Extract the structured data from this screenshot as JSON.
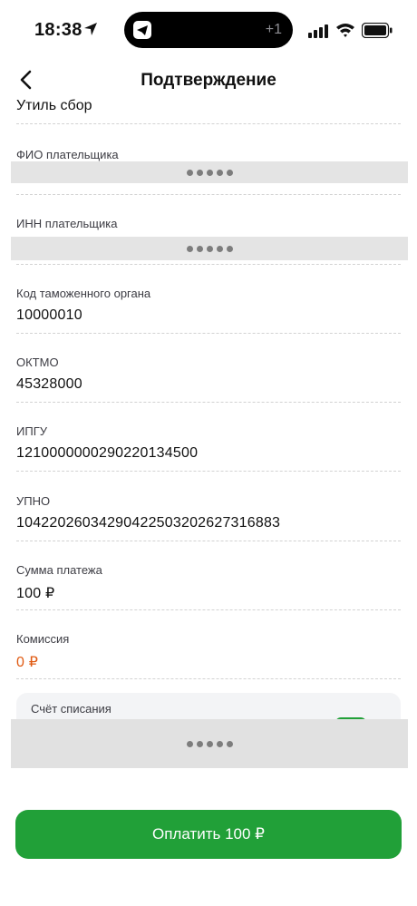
{
  "status_bar": {
    "time": "18:38",
    "notification_count": "+1",
    "icons": [
      "location-arrow-icon",
      "telegram-icon",
      "signal-icon",
      "wifi-icon",
      "battery-icon"
    ]
  },
  "nav": {
    "title": "Подтверждение",
    "back_icon": "chevron-left-icon"
  },
  "top_partial_value": "Утиль сбор",
  "fields": {
    "payer_name": {
      "label": "ФИО плательщика",
      "value": "•••••"
    },
    "payer_inn": {
      "label": "ИНН плательщика",
      "value": "•••••"
    },
    "customs_code": {
      "label": "Код таможенного органа",
      "value": "10000010"
    },
    "oktmo": {
      "label": "ОКТМО",
      "value": "45328000"
    },
    "ipgu": {
      "label": "ИПГУ",
      "value": "12100000002902201345​00"
    },
    "upno": {
      "label": "УПНО",
      "value": "10422026034290422503202627316883"
    },
    "amount": {
      "label": "Сумма платежа",
      "value": "100 ₽"
    },
    "commission": {
      "label": "Комиссия",
      "value": "0 ₽"
    }
  },
  "account": {
    "label": "Счёт списания",
    "value": "•••••"
  },
  "pay_button": {
    "label": "Оплатить 100 ₽"
  },
  "colors": {
    "accent_green": "#21a038",
    "commission_orange": "#e05a12",
    "mask_gray": "#e4e4e4",
    "divider": "#d2d2d2"
  }
}
